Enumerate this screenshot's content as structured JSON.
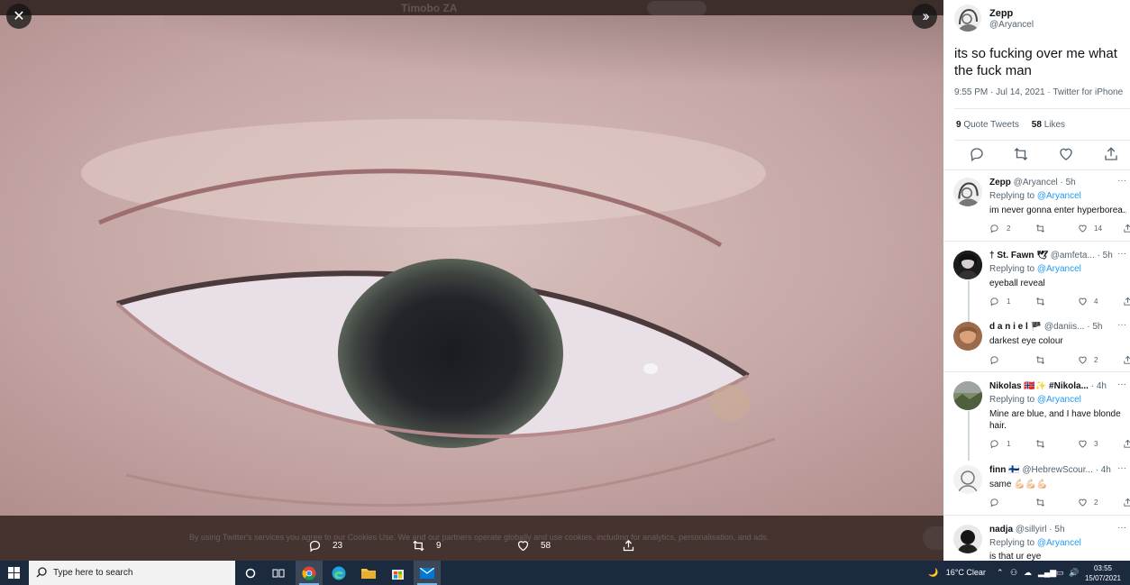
{
  "viewer": {
    "background_title": "Timobo ZA",
    "cookie_notice": "By using Twitter's services you agree to our Cookies Use. We and our partners operate globally and use cookies, including for analytics, personalisation, and ads.",
    "photo_stats": {
      "replies": "23",
      "retweets": "9",
      "likes": "58"
    }
  },
  "tweet": {
    "name": "Zepp",
    "handle": "@Aryancel",
    "text": "its so fucking over me what the fuck man",
    "meta": "9:55 PM · Jul 14, 2021 · Twitter for iPhone",
    "quote_count": "9",
    "quote_label": "Quote Tweets",
    "like_count": "58",
    "like_label": "Likes"
  },
  "replies": [
    {
      "name": "Zepp",
      "handle": "@Aryancel",
      "time": "· 5h",
      "replying_prefix": "Replying to",
      "replying_to": "@Aryancel",
      "text": "im never gonna enter hyperborea...",
      "reply_count": "2",
      "retweet_count": "",
      "like_count": "14"
    },
    {
      "name": "† St. Fawn 🕊",
      "handle": "@amfeta...",
      "time": "· 5h",
      "replying_prefix": "Replying to",
      "replying_to": "@Aryancel",
      "text": "eyeball reveal",
      "reply_count": "1",
      "retweet_count": "",
      "like_count": "4"
    },
    {
      "name": "d a n i e l 🏴",
      "handle": "@daniis...",
      "time": "· 5h",
      "replying_prefix": "",
      "replying_to": "",
      "text": "darkest eye colour",
      "reply_count": "",
      "retweet_count": "",
      "like_count": "2"
    },
    {
      "name": "Nikolas 🇳🇴✨ #Nikola...",
      "handle": "",
      "time": "· 4h",
      "replying_prefix": "Replying to",
      "replying_to": "@Aryancel",
      "text": "Mine are blue, and I have blonde hair.",
      "reply_count": "1",
      "retweet_count": "",
      "like_count": "3"
    },
    {
      "name": "finn 🇫🇮",
      "handle": "@HebrewScour...",
      "time": "· 4h",
      "replying_prefix": "",
      "replying_to": "",
      "text": "same 💪🏻💪🏻💪🏻",
      "reply_count": "",
      "retweet_count": "",
      "like_count": "2"
    },
    {
      "name": "nadja",
      "handle": "@sillyirl",
      "time": "· 5h",
      "replying_prefix": "Replying to",
      "replying_to": "@Aryancel",
      "text": "is that ur eye",
      "reply_count": "",
      "retweet_count": "",
      "like_count": ""
    }
  ],
  "taskbar": {
    "search_placeholder": "Type here to search",
    "weather": "16°C  Clear",
    "time": "03:55",
    "date": "15/07/2021"
  },
  "colors": {
    "link_blue": "#1d9bf0",
    "taskbar": "#1b2a3f",
    "viewer_bg": "#503c38"
  }
}
